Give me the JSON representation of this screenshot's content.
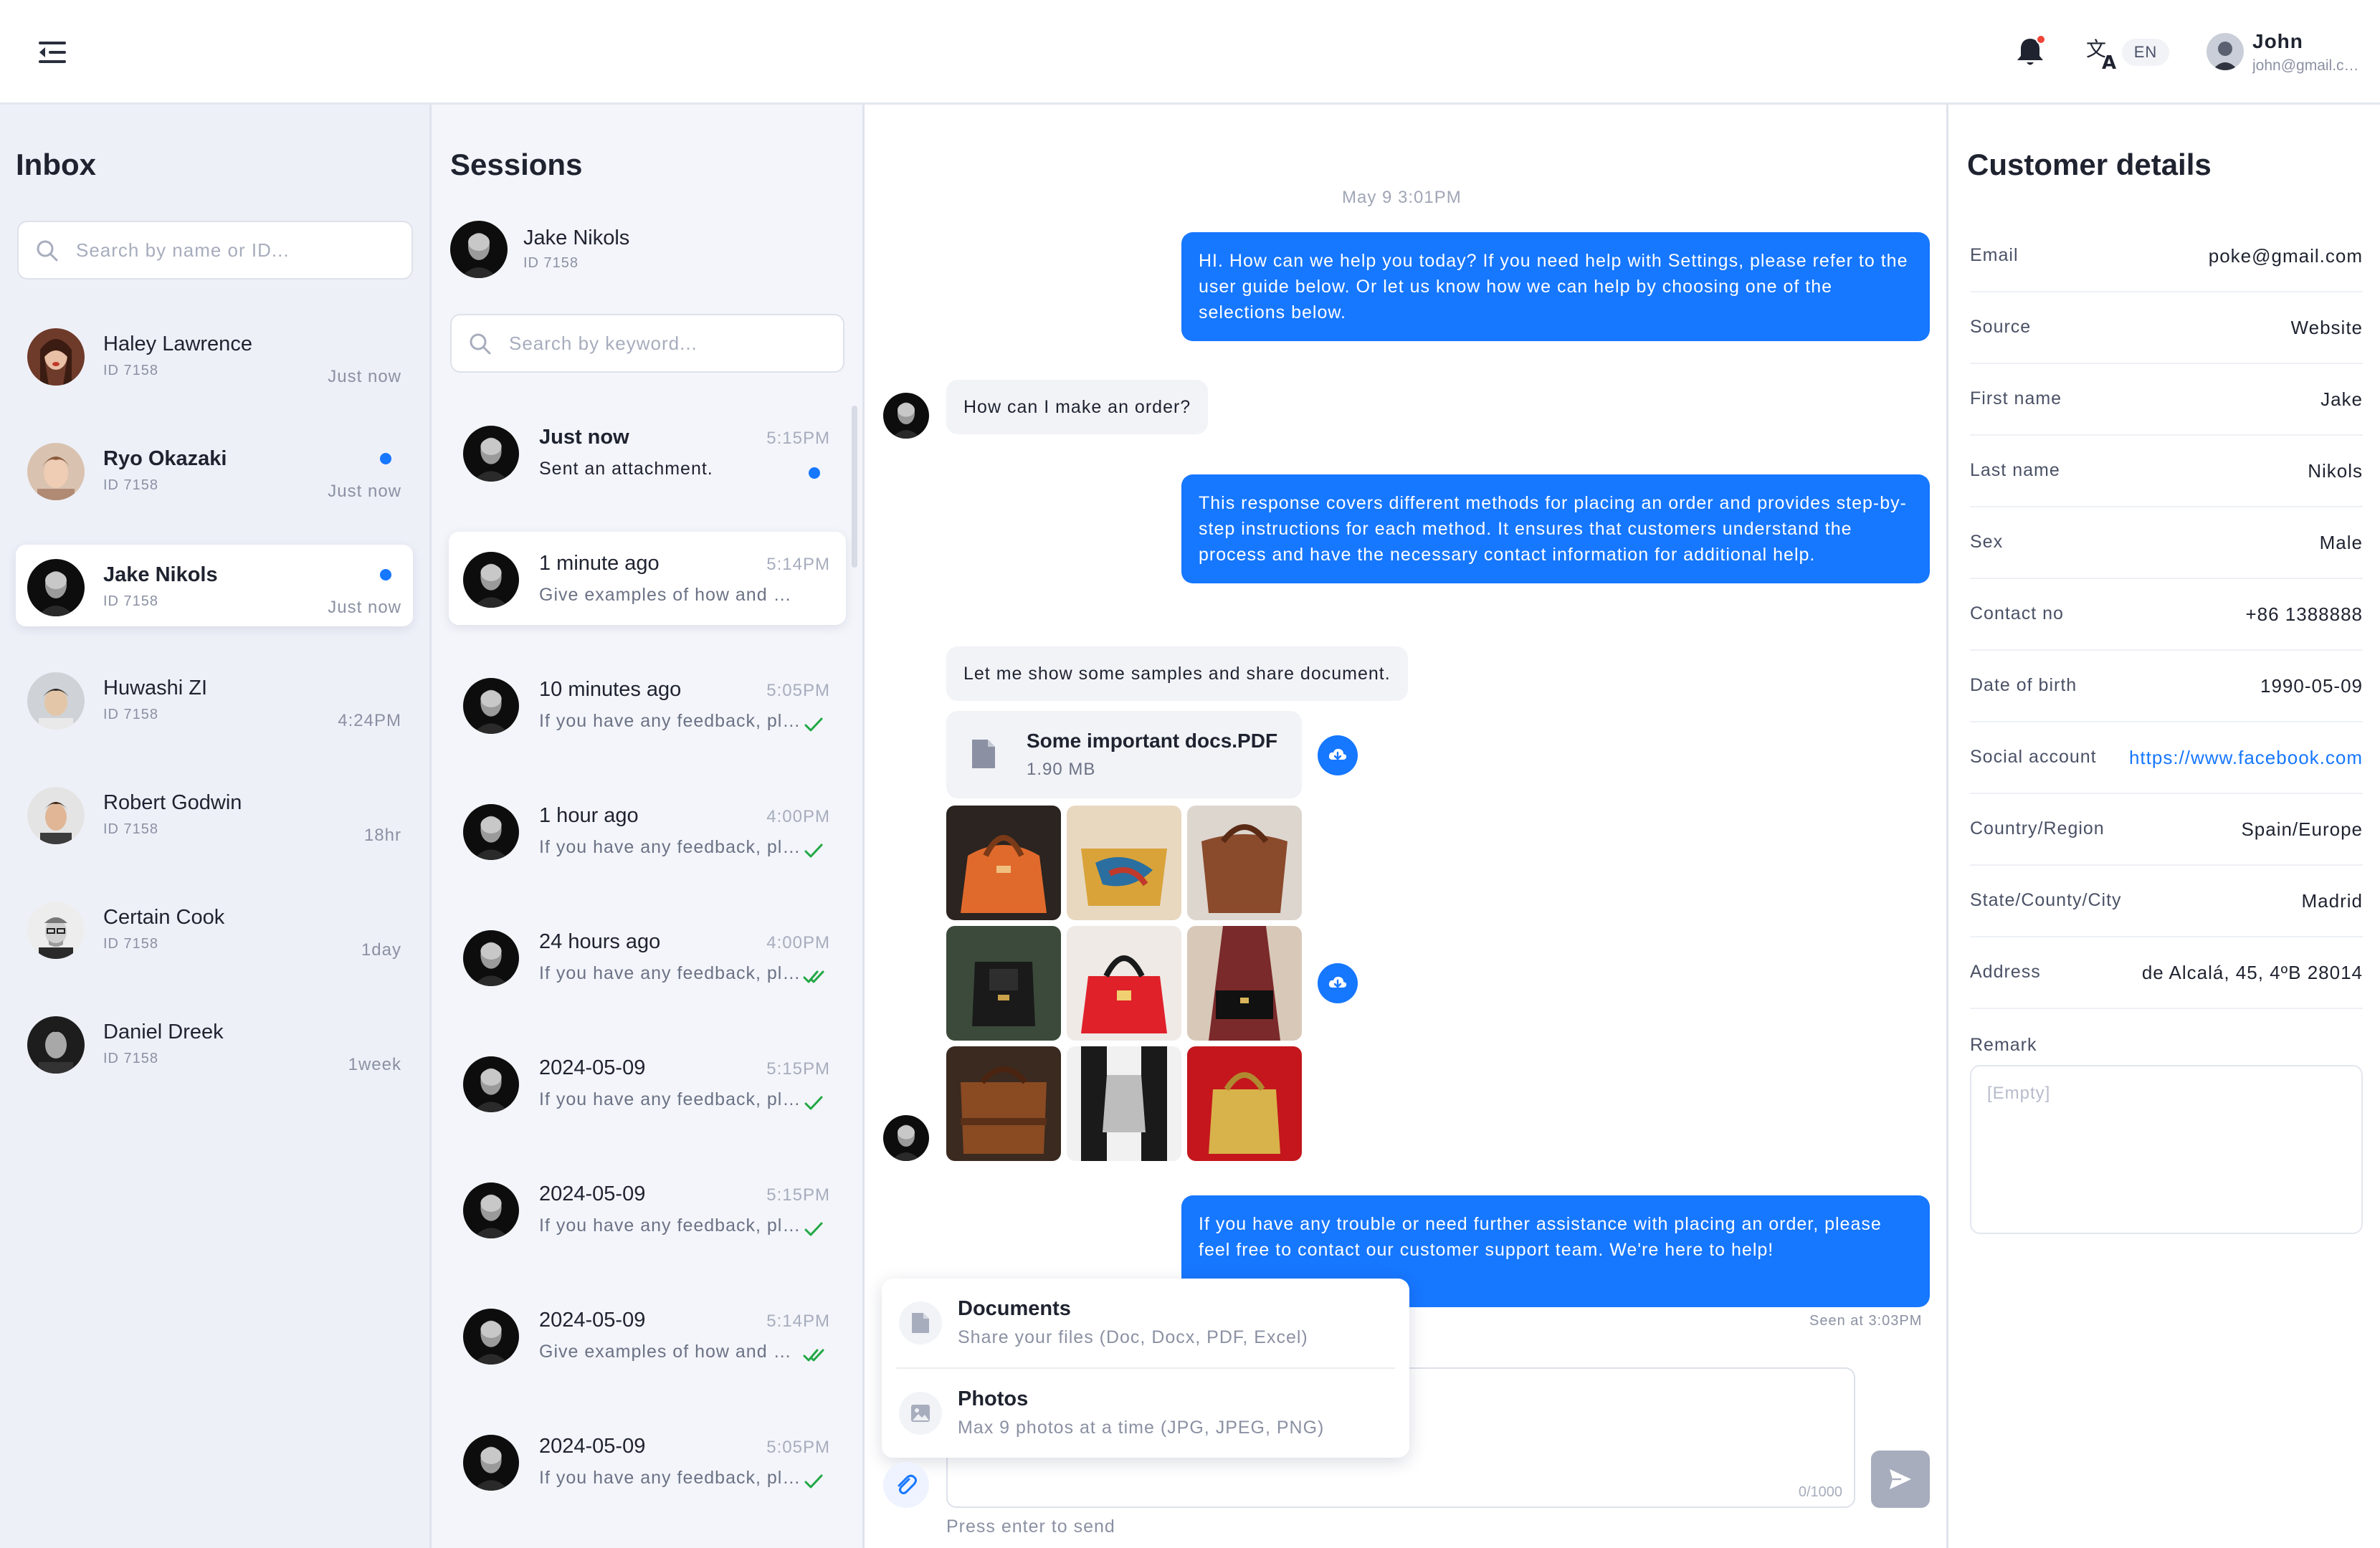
{
  "user": {
    "name": "John",
    "email": "john@gmail.com",
    "lang": "EN"
  },
  "inbox": {
    "title": "Inbox",
    "search_placeholder": "Search by name or ID...",
    "items": [
      {
        "name": "Haley Lawrence",
        "id": "ID 7158",
        "time": "Just now",
        "unread": false,
        "active": false
      },
      {
        "name": "Ryo Okazaki",
        "id": "ID 7158",
        "time": "Just now",
        "unread": true,
        "active": false
      },
      {
        "name": "Jake Nikols",
        "id": "ID 7158",
        "time": "Just now",
        "unread": true,
        "active": true
      },
      {
        "name": "Huwashi ZI",
        "id": "ID 7158",
        "time": "4:24PM",
        "unread": false,
        "active": false
      },
      {
        "name": "Robert Godwin",
        "id": "ID 7158",
        "time": "18hr",
        "unread": false,
        "active": false
      },
      {
        "name": "Certain Cook",
        "id": "ID 7158",
        "time": "1day",
        "unread": false,
        "active": false
      },
      {
        "name": "Daniel Dreek",
        "id": "ID 7158",
        "time": "1week",
        "unread": false,
        "active": false
      }
    ]
  },
  "sessions": {
    "title": "Sessions",
    "current": {
      "name": "Jake Nikols",
      "id": "ID 7158"
    },
    "search_placeholder": "Search by keyword...",
    "items": [
      {
        "title": "Just now",
        "time": "5:15PM",
        "preview": "Sent an attachment.",
        "status": "unread"
      },
      {
        "title": "1 minute ago",
        "time": "5:14PM",
        "preview": "Give examples of how and when to use it.",
        "status": "none"
      },
      {
        "title": "10 minutes ago",
        "time": "5:05PM",
        "preview": "If you have any feedback, please let us know.",
        "status": "sent"
      },
      {
        "title": "1 hour ago",
        "time": "4:00PM",
        "preview": "If you have any feedback, please let us know.",
        "status": "sent"
      },
      {
        "title": "24 hours ago",
        "time": "4:00PM",
        "preview": "If you have any feedback, please let us know.",
        "status": "read"
      },
      {
        "title": "2024-05-09",
        "time": "5:15PM",
        "preview": "If you have any feedback, please let us know.",
        "status": "sent"
      },
      {
        "title": "2024-05-09",
        "time": "5:15PM",
        "preview": "If you have any feedback, please let us know.",
        "status": "sent"
      },
      {
        "title": "2024-05-09",
        "time": "5:14PM",
        "preview": "Give examples of how and when to use it.",
        "status": "read"
      },
      {
        "title": "2024-05-09",
        "time": "5:05PM",
        "preview": "If you have any feedback, please let us know.",
        "status": "sent"
      }
    ]
  },
  "chat": {
    "date": "May 9 3:01PM",
    "msg1": "HI. How can we help you today? If you need help with Settings, please refer to the user guide below. Or let us know how we can help by choosing one of the selections below.",
    "msg2": "How can I make an order?",
    "msg3": "This response covers different methods for placing an order and provides step-by-step instructions for each method. It ensures that customers understand the process and have the necessary contact information for additional help.",
    "msg4": "Let me show some samples and share document.",
    "file": {
      "name": "Some important docs.PDF",
      "size": "1.90 MB"
    },
    "msg5": "If you have any trouble or need further assistance with placing an order, please feel free to contact our customer support team. We're here to help!",
    "seen": "Seen at 3:03PM",
    "attach_menu": {
      "documents": {
        "title": "Documents",
        "desc": "Share your files (Doc, Docx, PDF, Excel)"
      },
      "photos": {
        "title": "Photos",
        "desc": "Max 9 photos at a time (JPG, JPEG, PNG)"
      }
    },
    "char_count": "0/1000",
    "send_hint": "Press enter to send"
  },
  "details": {
    "title": "Customer details",
    "rows": [
      {
        "label": "Email",
        "value": "poke@gmail.com"
      },
      {
        "label": "Source",
        "value": "Website"
      },
      {
        "label": "First name",
        "value": "Jake"
      },
      {
        "label": "Last name",
        "value": "Nikols"
      },
      {
        "label": "Sex",
        "value": "Male"
      },
      {
        "label": "Contact no",
        "value": "+86 1388888"
      },
      {
        "label": "Date of birth",
        "value": "1990-05-09"
      },
      {
        "label": "Social account",
        "value": "https://www.facebook.com"
      },
      {
        "label": "Country/Region",
        "value": "Spain/Europe"
      },
      {
        "label": "State/County/City",
        "value": "Madrid"
      },
      {
        "label": "Address",
        "value": "de Alcalá, 45, 4ºB 28014"
      }
    ],
    "remark_label": "Remark",
    "remark_placeholder": "[Empty]"
  },
  "colors": {
    "accent": "#1677ff",
    "unread": "#1677ff",
    "check": "#22a845",
    "notify": "#f04438"
  }
}
